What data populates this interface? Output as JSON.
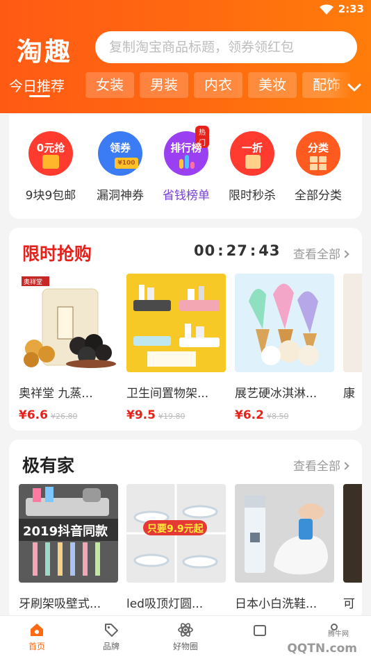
{
  "status_bar": {
    "time": "2:33"
  },
  "header": {
    "logo": "淘趣",
    "search_placeholder": "复制淘宝商品标题，领券领红包",
    "active_tab": "今日推荐",
    "tabs": [
      "女装",
      "男装",
      "内衣",
      "美妆",
      "配饰"
    ]
  },
  "categories": [
    {
      "label": "9块9包邮",
      "circle_text": "0元抢",
      "icon": "gift-icon",
      "color": "#ff3b30"
    },
    {
      "label": "漏洞神券",
      "circle_text": "领券",
      "icon": "coupon-icon",
      "color": "#3b7cf5",
      "deco_text": "¥100"
    },
    {
      "label": "省钱榜单",
      "circle_text": "排行榜",
      "icon": "ranking-icon",
      "color": "#9b3ff2",
      "badge": "热门"
    },
    {
      "label": "限时秒杀",
      "circle_text": "一折",
      "icon": "shopping-bag-icon",
      "color": "#ff3b30"
    },
    {
      "label": "全部分类",
      "circle_text": "分类",
      "icon": "grid-icon",
      "color": "#ff5a1f"
    }
  ],
  "flash_sale": {
    "title": "限时抢购",
    "countdown": {
      "h": "00",
      "m": "27",
      "s": "43"
    },
    "see_all": "查看全部",
    "products": [
      {
        "name": "奥祥堂 九蒸...",
        "price": "¥6.6",
        "original": "¥26.80",
        "image": "sesame-pills-jar",
        "brand": "奥祥堂"
      },
      {
        "name": "卫生间置物架...",
        "price": "¥9.5",
        "original": "¥19.80",
        "image": "bathroom-shelf"
      },
      {
        "name": "展艺硬冰淇淋...",
        "price": "¥6.2",
        "original": "¥8.50",
        "image": "ice-cream"
      },
      {
        "name": "康",
        "image": "partial-product"
      }
    ]
  },
  "home_section": {
    "title": "极有家",
    "see_all": "查看全部",
    "products": [
      {
        "name": "牙刷架吸壁式...",
        "image": "toothbrush-holder",
        "banner": "2019抖音同款"
      },
      {
        "name": "led吸顶灯圆...",
        "image": "ceiling-lamps",
        "banner": "只要9.9元起"
      },
      {
        "name": "日本小白洗鞋...",
        "image": "shoe-cleaner"
      },
      {
        "name": "可",
        "image": "partial-product"
      }
    ]
  },
  "bottom_nav": [
    {
      "label": "首页",
      "icon": "home-icon",
      "active": true
    },
    {
      "label": "品牌",
      "icon": "tag-icon",
      "active": false
    },
    {
      "label": "好物圈",
      "icon": "atom-icon",
      "active": false
    },
    {
      "label": "",
      "icon": "gift-box-icon",
      "active": false
    },
    {
      "label": "",
      "icon": "user-icon",
      "active": false
    }
  ],
  "watermark": {
    "text": "QQTN.com",
    "small": "腾牛网"
  },
  "colors": {
    "primary": "#ff6a12",
    "red": "#e8201a",
    "purple": "#9b3ff2",
    "blue": "#3b7cf5"
  }
}
